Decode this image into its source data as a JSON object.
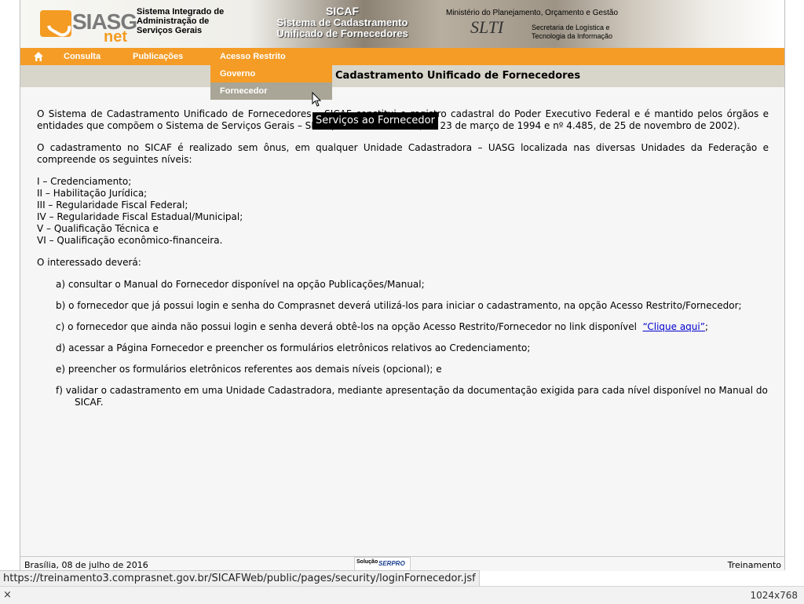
{
  "header": {
    "logo_main": "SIASG",
    "logo_sub": "net",
    "org_name": "Sistema Integrado de\nAdministração de\nServiços Gerais",
    "sicaf_acronym": "SICAF",
    "sicaf_full": "Sistema de Cadastramento\nUnificado de Fornecedores",
    "ministry": "Ministério do Planejamento, Orçamento e Gestão",
    "slti_logo": "SLTI",
    "slti_text": "Secretaria de Logística e\nTecnologia da Informação"
  },
  "nav": {
    "home_icon": "home-icon",
    "items": [
      "Consulta",
      "Publicações",
      "Acesso Restrito"
    ]
  },
  "dropdown": {
    "items": [
      "Governo",
      "Fornecedor"
    ],
    "tooltip": "Serviços ao Fornecedor"
  },
  "page": {
    "heading": "Cadastramento Unificado de Fornecedores"
  },
  "content": {
    "intro_1": "O Sistema de Cadastramento Unificado de Fornecedores – SICAF constitui o registro cadastral do Poder Executivo Federal e é mantido pelos órgãos e entidades que compõem o Sistema de Serviços Gerais – SISG (Decretos nº 1.094, de 23 de março de 1994 e nº 4.485, de 25 de novembro de 2002).",
    "intro_2": "O cadastramento no SICAF é realizado sem ônus, em qualquer Unidade Cadastradora – UASG localizada nas diversas Unidades da Federação e compreende os seguintes níveis:",
    "levels": [
      "I – Credenciamento;",
      "II – Habilitação Jurídica;",
      "III – Regularidade Fiscal Federal;",
      "IV – Regularidade Fiscal Estadual/Municipal;",
      "V – Qualificação Técnica e",
      "VI – Qualificação econômico-financeira."
    ],
    "should_intro": "O interessado deverá:",
    "step_a": "a) consultar o Manual do Fornecedor disponível na opção Publicações/Manual;",
    "step_b": "b) o fornecedor que já possui login e senha do Comprasnet deverá utilizá-los para iniciar o cadastramento, na opção Acesso Restrito/Fornecedor;",
    "step_c": "c) o fornecedor que ainda não possui login e senha deverá obtê-los na opção Acesso Restrito/Fornecedor no link disponível",
    "step_c_link": "“Clique aqui”",
    "step_c_end": ";",
    "step_d": "d) acessar a Página Fornecedor e preencher os formulários eletrônicos relativos ao Credenciamento;",
    "step_e": "e) preencher os formulários eletrônicos referentes aos demais níveis (opcional); e",
    "step_f_1": "f) validar o cadastramento em uma Unidade Cadastradora, mediante apresentação da documentação exigida para cada nível disponível no Manual do",
    "step_f_2": "SICAF."
  },
  "footer": {
    "date": "Brasília, 08 de julho de 2016",
    "solucao": "Solução",
    "serpro": "SERPRO",
    "mode": "Treinamento"
  },
  "browser": {
    "status_url": "https://treinamento3.comprasnet.gov.br/SICAFWeb/public/pages/security/loginFornecedor.jsf",
    "close": "×",
    "dimensions": "1024x768"
  },
  "colors": {
    "nav_orange": "#f59c26",
    "submenu_gray": "#d8d6cb",
    "link_blue": "#0000cc"
  }
}
